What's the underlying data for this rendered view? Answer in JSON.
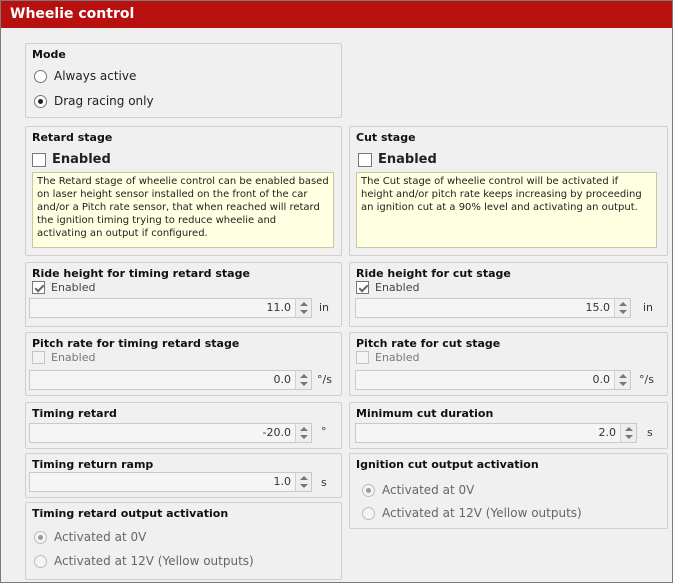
{
  "window": {
    "title": "Wheelie control"
  },
  "mode": {
    "title": "Mode",
    "options": [
      "Always active",
      "Drag racing only"
    ],
    "selected": "Drag racing only"
  },
  "retard_stage": {
    "title": "Retard stage",
    "enabled_label": "Enabled",
    "enabled": false,
    "description": "The Retard stage of wheelie control can be enabled based on laser height sensor installed on the front of the car and/or a Pitch rate sensor, that when reached will retard the ignition timing trying to reduce wheelie and activating an output if configured."
  },
  "cut_stage": {
    "title": "Cut stage",
    "enabled_label": "Enabled",
    "enabled": false,
    "description": "The Cut stage of wheelie control will be activated if height and/or pitch rate keeps increasing by proceeding an ignition cut at a 90% level and activating an output."
  },
  "ride_height_retard": {
    "title": "Ride height for timing retard stage",
    "enabled_label": "Enabled",
    "enabled": true,
    "value": "11.0",
    "unit": "in"
  },
  "ride_height_cut": {
    "title": "Ride height for cut stage",
    "enabled_label": "Enabled",
    "enabled": true,
    "value": "15.0",
    "unit": "in"
  },
  "pitch_rate_retard": {
    "title": "Pitch rate for timing retard stage",
    "enabled_label": "Enabled",
    "enabled": false,
    "value": "0.0",
    "unit": "°/s"
  },
  "pitch_rate_cut": {
    "title": "Pitch rate for cut stage",
    "enabled_label": "Enabled",
    "enabled": false,
    "value": "0.0",
    "unit": "°/s"
  },
  "timing_retard": {
    "title": "Timing retard",
    "value": "-20.0",
    "unit": "°"
  },
  "min_cut_duration": {
    "title": "Minimum cut duration",
    "value": "2.0",
    "unit": "s"
  },
  "timing_return_ramp": {
    "title": "Timing return ramp",
    "value": "1.0",
    "unit": "s"
  },
  "ignition_cut_output": {
    "title": "Ignition cut output activation",
    "options": [
      "Activated at 0V",
      "Activated at 12V (Yellow outputs)"
    ],
    "selected": "Activated at 0V"
  },
  "timing_retard_output": {
    "title": "Timing retard output activation",
    "options": [
      "Activated at 0V",
      "Activated at 12V (Yellow outputs)"
    ],
    "selected": "Activated at 0V"
  },
  "colors": {
    "titlebar": "#b80f0f",
    "description_bg": "#ffffe1"
  },
  "icons": {
    "spin_up": "chevron-up-icon",
    "spin_down": "chevron-down-icon"
  }
}
